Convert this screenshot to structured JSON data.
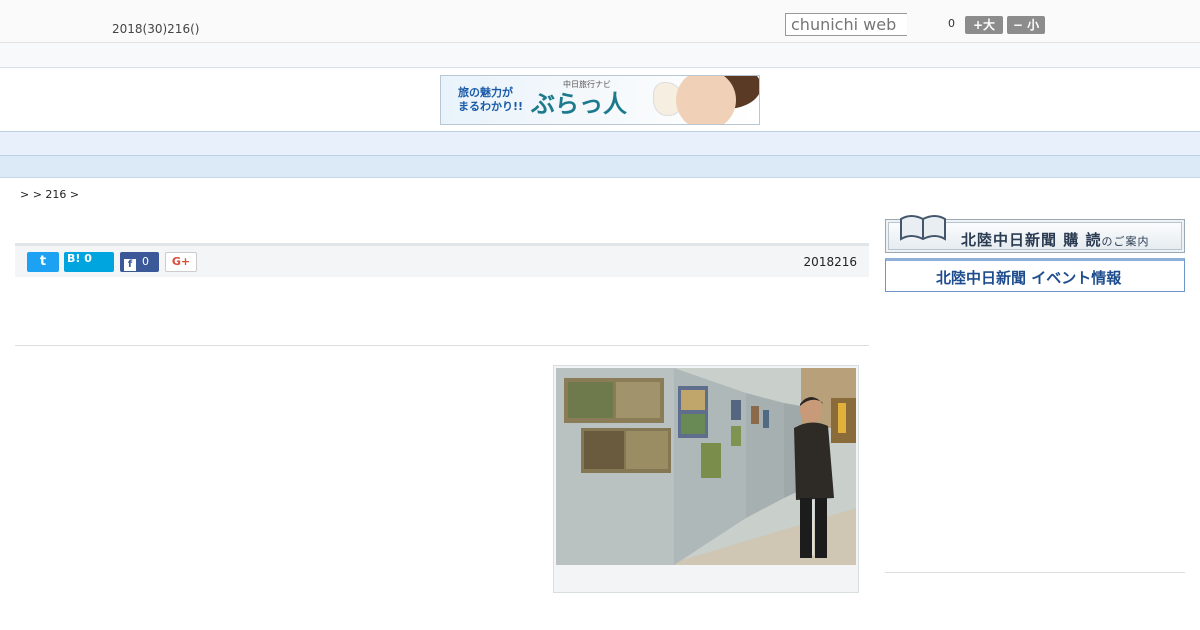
{
  "header": {
    "date": "2018(30)216()",
    "search_placeholder": "chunichi web",
    "font_count": "0",
    "font_bigger": "+大",
    "font_smaller": "− 小"
  },
  "banner": {
    "tagline_line1": "旅の魅力が",
    "tagline_line2": "まるわかり!!",
    "brand_small": "中日旅行ナビ",
    "brand": "ぶらっ人"
  },
  "nav": {
    "items": [
      "",
      "",
      "",
      "",
      "",
      "",
      "",
      "",
      ""
    ]
  },
  "breadcrumb": {
    "text": ">  > 216 >"
  },
  "article": {
    "share": {
      "twitter_icon_label": "t",
      "hatena_label": "B! 0",
      "facebook_icon_label": "f",
      "facebook_count": "0",
      "gplus_label": "G+"
    },
    "date": "2018216"
  },
  "sidebar": {
    "subscribe_banner": "北陸中日新聞",
    "subscribe_banner_strong": "購 読",
    "subscribe_banner_suffix": "のご案内",
    "events_banner": "北陸中日新聞 イベント情報"
  }
}
